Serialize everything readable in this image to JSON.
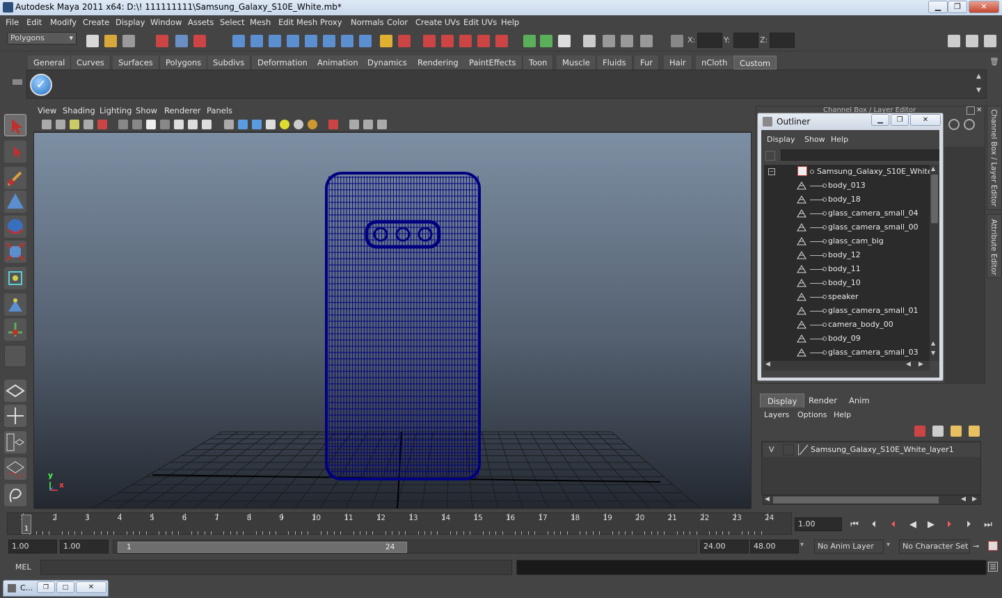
{
  "window": {
    "title": "Autodesk Maya 2011 x64: D:\\! 111111111\\Samsung_Galaxy_S10E_White.mb*"
  },
  "menubar": [
    "File",
    "Edit",
    "Modify",
    "Create",
    "Display",
    "Window",
    "Assets",
    "Select",
    "Mesh",
    "Edit Mesh",
    "Proxy",
    "Normals",
    "Color",
    "Create UVs",
    "Edit UVs",
    "Help"
  ],
  "statusline": {
    "mode": "Polygons",
    "x_label": "X:",
    "y_label": "Y:",
    "z_label": "Z:"
  },
  "shelf_tabs": [
    "General",
    "Curves",
    "Surfaces",
    "Polygons",
    "Subdivs",
    "Deformation",
    "Animation",
    "Dynamics",
    "Rendering",
    "PaintEffects",
    "Toon",
    "Muscle",
    "Fluids",
    "Fur",
    "Hair",
    "nCloth",
    "Custom"
  ],
  "shelf_active": "Custom",
  "viewport_menu": [
    "View",
    "Shading",
    "Lighting",
    "Show",
    "Renderer",
    "Panels"
  ],
  "axis": {
    "x": "x",
    "y": "y"
  },
  "channel_box": {
    "title": "Channel Box / Layer Editor"
  },
  "side_tabs": [
    "Channel Box / Layer Editor",
    "Attribute Editor"
  ],
  "outliner": {
    "title": "Outliner",
    "menu": [
      "Display",
      "Show",
      "Help"
    ],
    "root": "Samsung_Galaxy_S10E_White",
    "items": [
      "body_013",
      "body_18",
      "glass_camera_small_04",
      "glass_camera_small_00",
      "glass_cam_big",
      "body_12",
      "body_11",
      "body_10",
      "speaker",
      "glass_camera_small_01",
      "camera_body_00",
      "body_09",
      "glass_camera_small_03"
    ]
  },
  "layer_editor": {
    "tabs": [
      "Display",
      "Render",
      "Anim"
    ],
    "active_tab": "Display",
    "menu": [
      "Layers",
      "Options",
      "Help"
    ],
    "layers": [
      {
        "visible": "V",
        "name": "Samsung_Galaxy_S10E_White_layer1"
      }
    ]
  },
  "time_slider": {
    "ticks": [
      "1",
      "2",
      "3",
      "4",
      "5",
      "6",
      "7",
      "8",
      "9",
      "10",
      "11",
      "12",
      "13",
      "14",
      "15",
      "16",
      "17",
      "18",
      "19",
      "20",
      "21",
      "22",
      "23",
      "24"
    ],
    "current_frame": "1",
    "current_time": "1.00"
  },
  "range_slider": {
    "start": "1.00",
    "playback_start": "1.00",
    "range_start_label": "1",
    "range_end_label": "24",
    "playback_end": "24.00",
    "end": "48.00",
    "anim_layer": "No Anim Layer",
    "character_set": "No Character Set"
  },
  "command_line": {
    "label": "MEL"
  },
  "taskbar": {
    "label": "C..."
  },
  "colors": {
    "wireframe": "#000080",
    "viewport_top": "#7d8fa3",
    "viewport_bottom": "#232830",
    "ui_bg": "#444444"
  }
}
